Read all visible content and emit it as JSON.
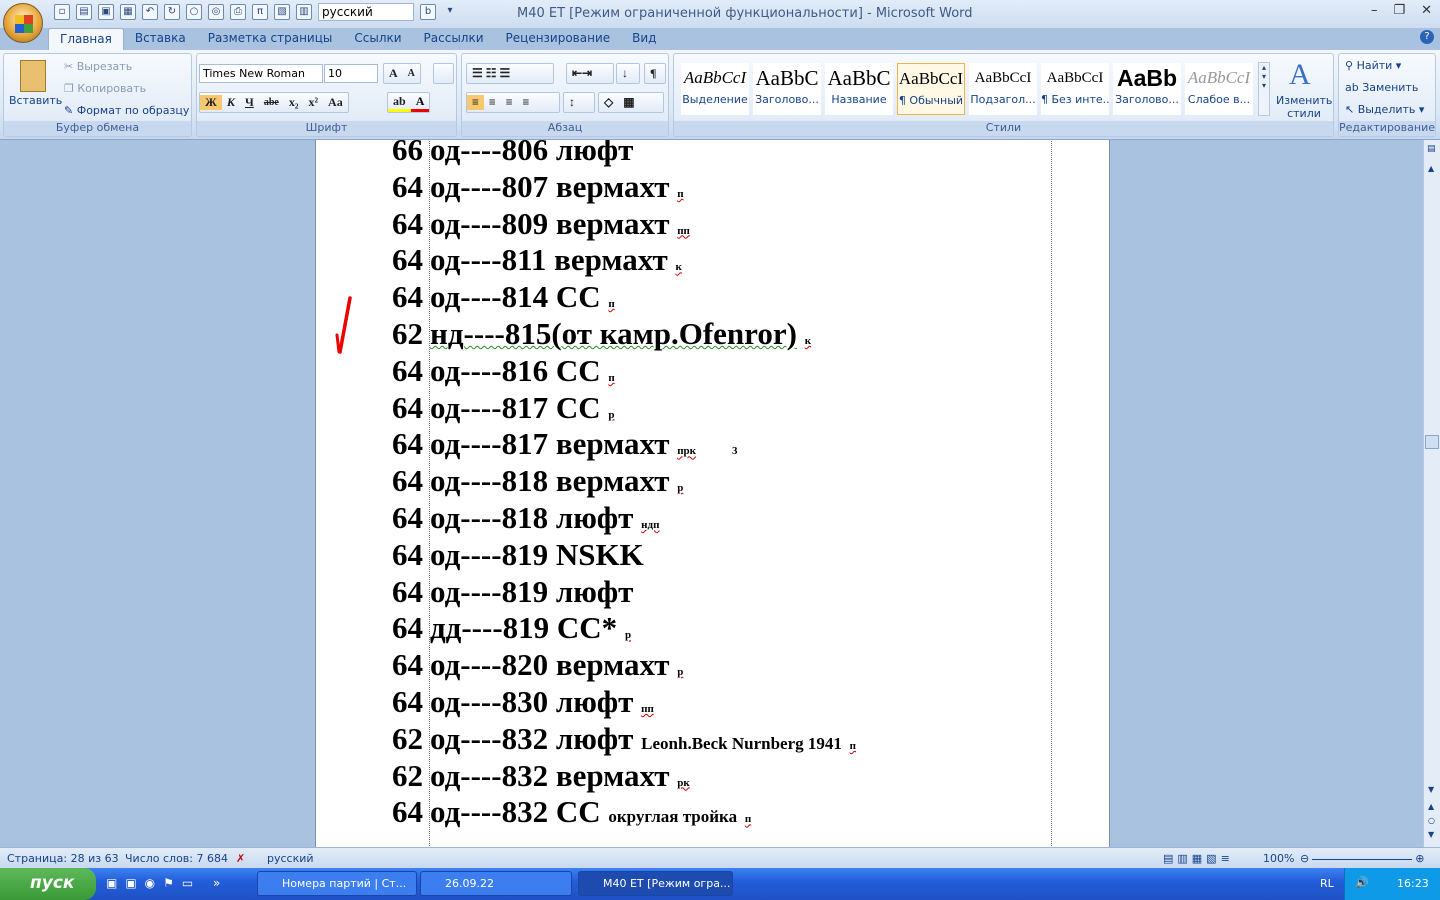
{
  "title": "M40 ET [Режим ограниченной функциональности] - Microsoft Word",
  "qat": {
    "language": "русский"
  },
  "tabs": [
    "Главная",
    "Вставка",
    "Разметка страницы",
    "Ссылки",
    "Рассылки",
    "Рецензирование",
    "Вид"
  ],
  "clipboard": {
    "paste": "Вставить",
    "cut": "Вырезать",
    "copy": "Копировать",
    "format_painter": "Формат по образцу",
    "label": "Буфер обмена"
  },
  "font": {
    "name": "Times New Roman",
    "size": "10",
    "label": "Шрифт",
    "bold": "Ж",
    "italic": "К",
    "underline": "Ч",
    "strike": "abe",
    "sub": "x₂",
    "sup": "x²",
    "case": "Aa",
    "grow": "A",
    "shrink": "A"
  },
  "paragraph": {
    "label": "Абзац",
    "pilcrow": "¶"
  },
  "styles": {
    "label": "Стили",
    "items": [
      {
        "preview": "AaBbCcI",
        "name": "Выделение"
      },
      {
        "preview": "AaBbC",
        "name": "Заголово..."
      },
      {
        "preview": "AaBbC",
        "name": "Название"
      },
      {
        "preview": "AaBbCcI",
        "name": "¶ Обычный"
      },
      {
        "preview": "AaBbCcI",
        "name": "Подзагол..."
      },
      {
        "preview": "AaBbCcI",
        "name": "¶ Без инте..."
      },
      {
        "preview": "AaBb",
        "name": "Заголово..."
      },
      {
        "preview": "AaBbCcI",
        "name": "Слабое в..."
      }
    ],
    "change": "Изменить стили"
  },
  "editing": {
    "find": "Найти",
    "replace": "Заменить",
    "select": "Выделить",
    "label": "Редактирование"
  },
  "document": {
    "lines": [
      {
        "num": "66",
        "text": "од----806 люфт",
        "note": ""
      },
      {
        "num": "64",
        "text": "од----807 вермахт",
        "note": "п"
      },
      {
        "num": "64",
        "text": "од----809 вермахт",
        "note": "пп"
      },
      {
        "num": "64",
        "text": "од----811 вермахт",
        "note": "к"
      },
      {
        "num": "64",
        "text": "од----814 СС",
        "note": "п"
      },
      {
        "num": "62",
        "text": "нд----815(от камр.Ofenror)",
        "note": "к"
      },
      {
        "num": "64",
        "text": "од----816 СС",
        "note": "п"
      },
      {
        "num": "64",
        "text": "од----817 СС",
        "note": "р"
      },
      {
        "num": "64",
        "text": "од----817 вермахт",
        "note": "прк",
        "extra2": "3"
      },
      {
        "num": "64",
        "text": "од----818 вермахт",
        "note": "р"
      },
      {
        "num": "64",
        "text": "од----818 люфт",
        "note": "ндп"
      },
      {
        "num": "64",
        "text": "од----819 NSKK",
        "note": ""
      },
      {
        "num": "64",
        "text": "од----819 люфт",
        "note": ""
      },
      {
        "num": "64",
        "text": "дд----819 СС*",
        "note": "р"
      },
      {
        "num": "64",
        "text": "од----820 вермахт",
        "note": "р"
      },
      {
        "num": "64",
        "text": "од----830 люфт",
        "note": "пп"
      },
      {
        "num": "62",
        "text": "од----832 люфт",
        "extra": "Leonh.Beck Nurnberg 1941",
        "note": "п"
      },
      {
        "num": "62",
        "text": "од----832 вермахт",
        "note": "рк"
      },
      {
        "num": "64",
        "text": "од----832 СС",
        "extra": "округлая тройка",
        "note": "п"
      }
    ]
  },
  "status": {
    "page": "Страница: 28 из 63",
    "words": "Число слов: 7 684",
    "language": "русский",
    "zoom": "100%"
  },
  "taskbar": {
    "start": "пуск",
    "tasks": [
      "Номера партий | Ст...",
      "26.09.22",
      "M40 ET [Режим огра..."
    ],
    "lang": "RL",
    "clock": "16:23"
  }
}
